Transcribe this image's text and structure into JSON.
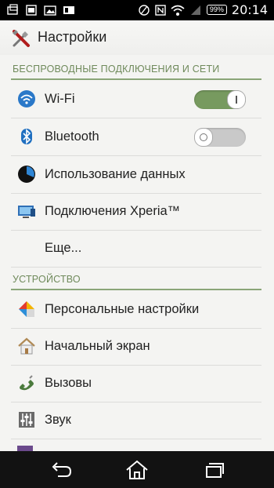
{
  "status_bar": {
    "battery": "99%",
    "time": "20:14"
  },
  "app_bar": {
    "title": "Настройки",
    "icon": "settings-tools-icon"
  },
  "sections": {
    "wireless": "БЕСПРОВОДНЫЕ ПОДКЛЮЧЕНИЯ И СЕТИ",
    "device": "УСТРОЙСТВО"
  },
  "items": {
    "wifi": {
      "label": "Wi-Fi",
      "icon": "wifi-icon",
      "enabled": true
    },
    "bluetooth": {
      "label": "Bluetooth",
      "icon": "bluetooth-icon",
      "enabled": false
    },
    "data_usage": {
      "label": "Использование данных",
      "icon": "data-usage-icon"
    },
    "xperia": {
      "label": "Подключения Xperia™",
      "icon": "xperia-connections-icon"
    },
    "more": {
      "label": "Еще..."
    },
    "personal": {
      "label": "Персональные настройки",
      "icon": "personalization-icon"
    },
    "home_screen": {
      "label": "Начальный экран",
      "icon": "home-screen-icon"
    },
    "calls": {
      "label": "Вызовы",
      "icon": "phone-icon"
    },
    "sound": {
      "label": "Звук",
      "icon": "sound-equalizer-icon"
    }
  },
  "colors": {
    "accent_green": "#779a5f",
    "section_text": "#6f8a5b",
    "background": "#f4f4f2"
  },
  "nav_bar": {
    "back": "back-icon",
    "home": "home-icon",
    "recents": "recents-icon"
  }
}
